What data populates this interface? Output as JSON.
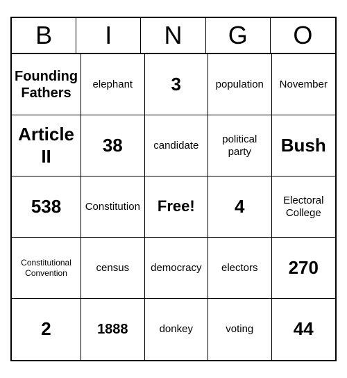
{
  "header": {
    "letters": [
      "B",
      "I",
      "N",
      "G",
      "O"
    ]
  },
  "cells": [
    {
      "text": "Founding Fathers",
      "size": "medium"
    },
    {
      "text": "elephant",
      "size": "normal"
    },
    {
      "text": "3",
      "size": "large"
    },
    {
      "text": "population",
      "size": "normal"
    },
    {
      "text": "November",
      "size": "normal"
    },
    {
      "text": "Article II",
      "size": "large"
    },
    {
      "text": "38",
      "size": "large"
    },
    {
      "text": "candidate",
      "size": "normal"
    },
    {
      "text": "political party",
      "size": "normal"
    },
    {
      "text": "Bush",
      "size": "large"
    },
    {
      "text": "538",
      "size": "large"
    },
    {
      "text": "Constitution",
      "size": "normal"
    },
    {
      "text": "Free!",
      "size": "free"
    },
    {
      "text": "4",
      "size": "large"
    },
    {
      "text": "Electoral College",
      "size": "normal"
    },
    {
      "text": "Constitutional Convention",
      "size": "small"
    },
    {
      "text": "census",
      "size": "normal"
    },
    {
      "text": "democracy",
      "size": "normal"
    },
    {
      "text": "electors",
      "size": "normal"
    },
    {
      "text": "270",
      "size": "large"
    },
    {
      "text": "2",
      "size": "large"
    },
    {
      "text": "1888",
      "size": "medium"
    },
    {
      "text": "donkey",
      "size": "normal"
    },
    {
      "text": "voting",
      "size": "normal"
    },
    {
      "text": "44",
      "size": "large"
    }
  ]
}
